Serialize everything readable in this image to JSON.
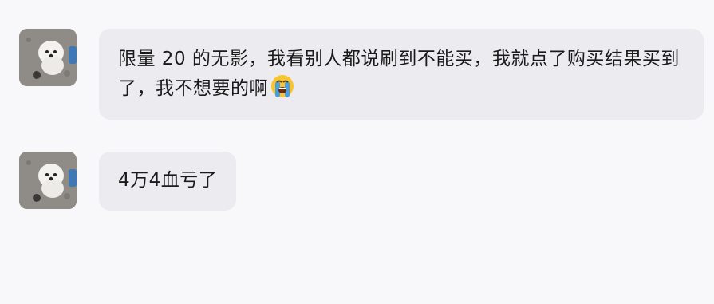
{
  "messages": [
    {
      "sender": "dog-avatar",
      "text": "限量 20 的无影，我看别人都说刷到不能买，我就点了购买结果买到了，我不想要的啊",
      "emoji": "loudly-crying-face"
    },
    {
      "sender": "dog-avatar",
      "text": "4万4血亏了"
    }
  ],
  "colors": {
    "background": "#f8f8fa",
    "bubble": "#ececf0",
    "text": "#1a1a1a"
  }
}
